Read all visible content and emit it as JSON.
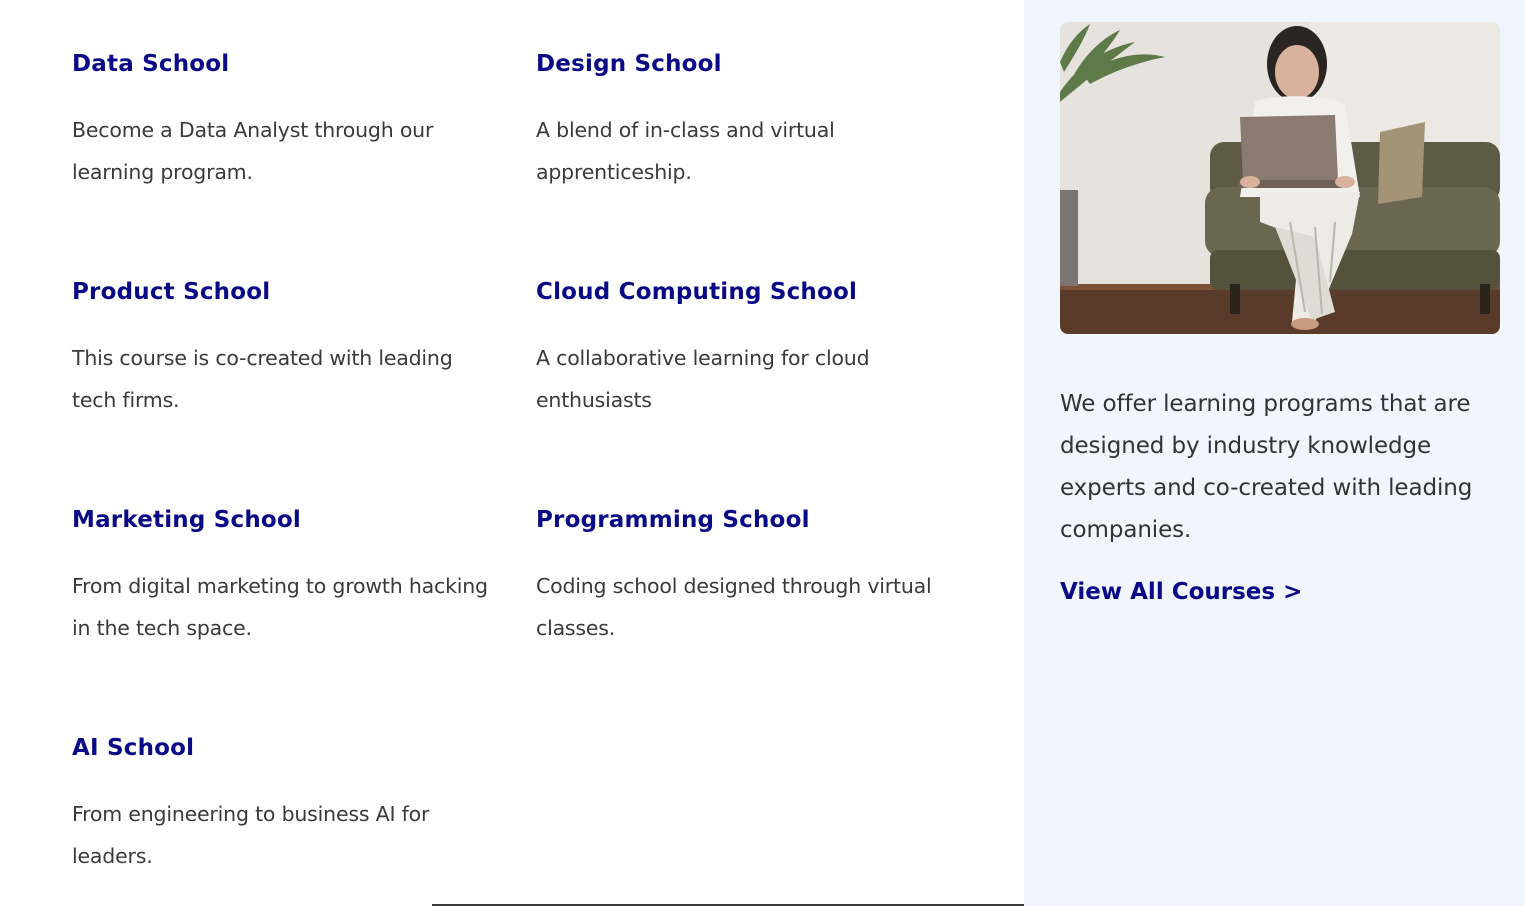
{
  "schools": [
    {
      "title": "Data School",
      "desc": "Become a Data Analyst through our learning program."
    },
    {
      "title": "Design School",
      "desc": "A blend of in-class and virtual apprenticeship."
    },
    {
      "title": "Product School",
      "desc": "This course is co-created with leading tech firms."
    },
    {
      "title": "Cloud Computing School",
      "desc": "A collaborative learning for cloud enthusiasts"
    },
    {
      "title": "Marketing School",
      "desc": "From digital marketing to growth hacking in the tech space."
    },
    {
      "title": "Programming School",
      "desc": "Coding school designed through virtual classes."
    },
    {
      "title": "AI School",
      "desc": "From engineering to business AI for leaders."
    }
  ],
  "aside": {
    "image_icon": "woman-on-couch-with-laptop-photo",
    "text": "We offer learning programs that are designed by industry knowledge experts and co-created with leading companies.",
    "view_all_label": "View All Courses >"
  },
  "colors": {
    "heading": "#0a0a87",
    "body_text": "#3a3a3a",
    "aside_background": "#f1f5fd"
  }
}
